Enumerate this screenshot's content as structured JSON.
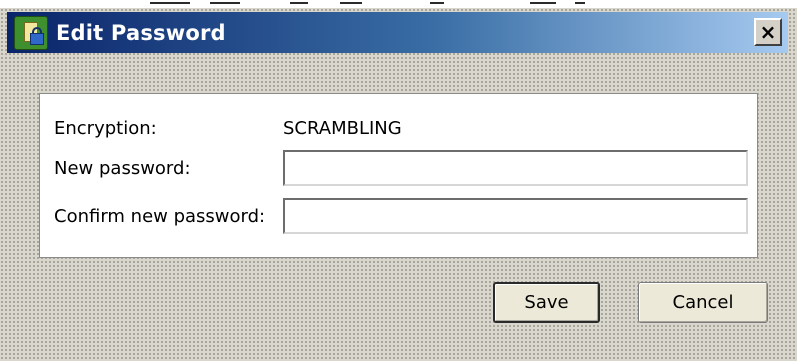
{
  "window": {
    "title": "Edit Password",
    "close_label": "×",
    "icon": "password-app-icon"
  },
  "form": {
    "encryption_label": "Encryption:",
    "encryption_value": "SCRAMBLING",
    "new_password_label": "New password:",
    "new_password_value": "",
    "confirm_password_label": "Confirm new password:",
    "confirm_password_value": ""
  },
  "buttons": {
    "save_label": "Save",
    "cancel_label": "Cancel"
  },
  "colors": {
    "titlebar_start": "#0a246a",
    "titlebar_end": "#a6caf0",
    "dialog_background": "#d8d6cd"
  }
}
